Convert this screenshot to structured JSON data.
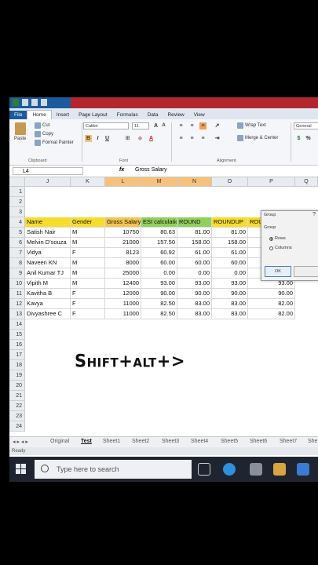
{
  "tabs": [
    "File",
    "Home",
    "Insert",
    "Page Layout",
    "Formulas",
    "Data",
    "Review",
    "View"
  ],
  "ribbon": {
    "cut": "Cut",
    "copy": "Copy",
    "paste": "Paste",
    "format_painter": "Format Painter",
    "clipboard": "Clipboard",
    "font_name": "Calibri",
    "font_size": "11",
    "font": "Font",
    "wrap_text": "Wrap Text",
    "merge_center": "Merge & Center",
    "alignment": "Alignment",
    "number_format": "General"
  },
  "formula_bar": {
    "name_box": "L4",
    "fx": "fx",
    "value": "Gross Salary"
  },
  "columns": [
    "J",
    "K",
    "L",
    "M",
    "N",
    "O",
    "P",
    "Q"
  ],
  "rows": [
    "1",
    "2",
    "3",
    "4",
    "5",
    "6",
    "7",
    "8",
    "9",
    "10",
    "11",
    "12",
    "13",
    "14",
    "15",
    "16",
    "17",
    "18",
    "19",
    "20",
    "21",
    "22",
    "23",
    "24"
  ],
  "headers": [
    "Name",
    "Gender",
    "Gross Salary",
    "ESI calculation",
    "ROUND",
    "ROUNDUP",
    "ROUNDDOWN"
  ],
  "data_rows": [
    [
      "Satish Nair",
      "M",
      "10750",
      "80.63",
      "81.00",
      "81.00",
      ""
    ],
    [
      "Melvin D'souza",
      "M",
      "21000",
      "157.50",
      "158.00",
      "158.00",
      ""
    ],
    [
      "Vidya",
      "F",
      "8123",
      "60.92",
      "61.00",
      "61.00",
      ""
    ],
    [
      "Naveen KN",
      "M",
      "8000",
      "60.00",
      "60.00",
      "60.00",
      ""
    ],
    [
      "Anil Kumar TJ",
      "M",
      "25000",
      "0.00",
      "0.00",
      "0.00",
      ""
    ],
    [
      "Vipith M",
      "M",
      "12400",
      "93.00",
      "93.00",
      "93.00",
      "93.00"
    ],
    [
      "Kavitha B",
      "F",
      "12000",
      "90.00",
      "90.00",
      "90.00",
      "90.00"
    ],
    [
      "Kavya",
      "F",
      "11000",
      "82.50",
      "83.00",
      "83.00",
      "82.00"
    ],
    [
      "Divyashree C",
      "F",
      "11000",
      "82.50",
      "83.00",
      "83.00",
      "82.00"
    ]
  ],
  "dialog": {
    "title": "Group",
    "close": "?",
    "group_label": "Group",
    "rows": "Rows",
    "columns": "Columns",
    "ok": "OK"
  },
  "sheets": [
    "Original",
    "Test",
    "Sheet1",
    "Sheet2",
    "Sheet3",
    "Sheet4",
    "Sheet5",
    "Sheet6",
    "Sheet7",
    "She"
  ],
  "status": "Ready",
  "taskbar": {
    "search_placeholder": "Type here to search"
  },
  "overlay_text": "Shift+alt+>"
}
